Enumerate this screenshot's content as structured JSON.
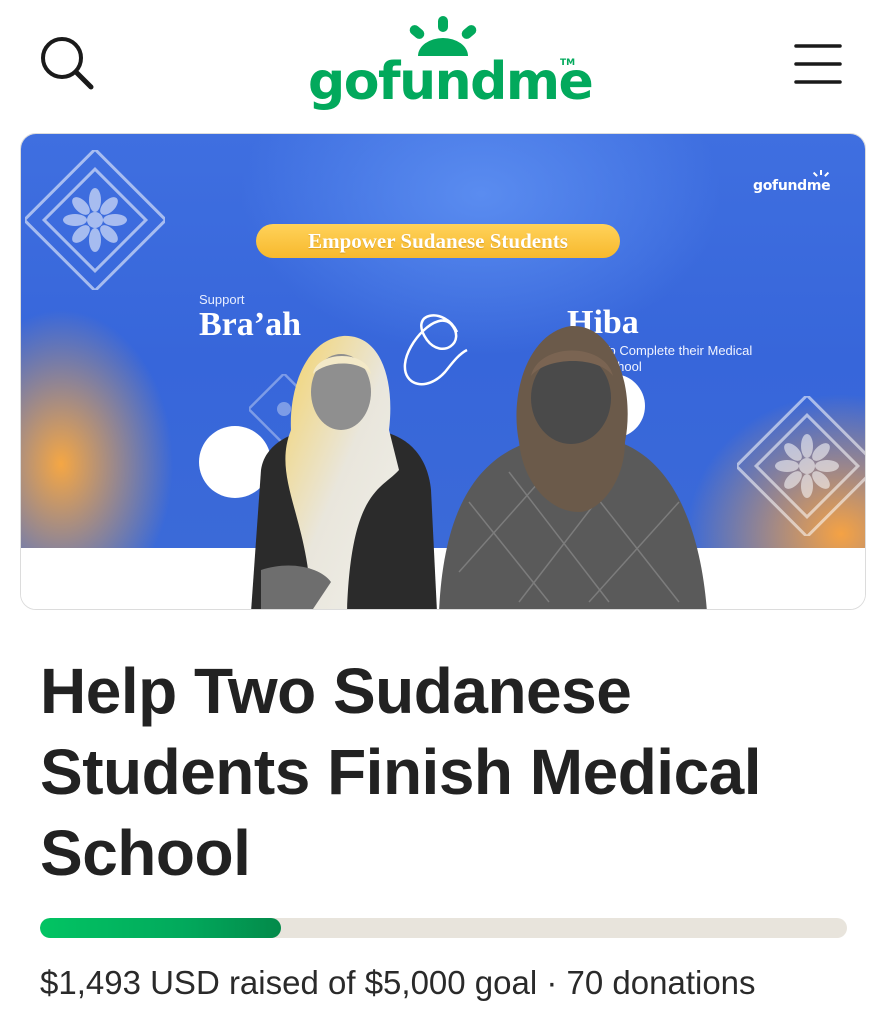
{
  "header": {
    "logo_text": "gofundme",
    "logo_tm": "TM",
    "search_icon": "search-icon",
    "menu_icon": "hamburger-menu-icon",
    "brand_color": "#02a95c"
  },
  "hero": {
    "brand": "gofundme",
    "banner": "Empower Sudanese Students",
    "support_label": "Support",
    "name_left": "Bra’ah",
    "name_right": "Hiba",
    "subtitle": "To Complete their Medical School",
    "background_color": "#3766da",
    "accent_color": "#f7b92d"
  },
  "campaign": {
    "title": "Help Two Sudanese Students Finish Medical School",
    "raised": "$1,493 USD raised",
    "goal_text": "of $5,000 goal",
    "separator": "·",
    "donations": "70 donations",
    "progress_fraction": 0.2986,
    "progress_color": "#02a95c",
    "track_color": "#e8e4dc"
  }
}
